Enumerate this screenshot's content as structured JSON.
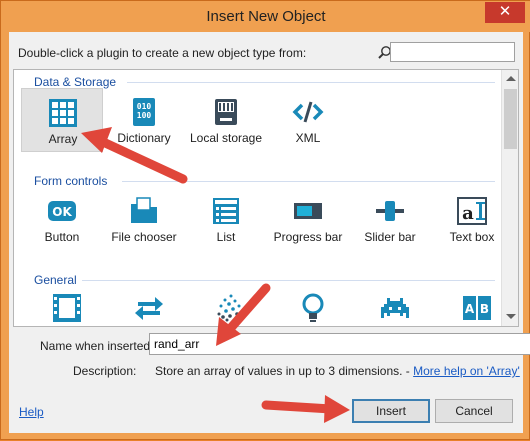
{
  "window": {
    "title": "Insert New Object",
    "close_glyph": "✕"
  },
  "instruction": "Double-click a plugin to create a new object type from:",
  "search": {
    "value": "",
    "placeholder": ""
  },
  "categories": [
    {
      "label": "Data & Storage",
      "items": [
        {
          "label": "Array",
          "icon": "grid-icon"
        },
        {
          "label": "Dictionary",
          "icon": "binary-icon"
        },
        {
          "label": "Local storage",
          "icon": "storage-icon"
        },
        {
          "label": "XML",
          "icon": "code-icon"
        }
      ]
    },
    {
      "label": "Form controls",
      "items": [
        {
          "label": "Button",
          "icon": "ok-button-icon"
        },
        {
          "label": "File chooser",
          "icon": "folder-icon"
        },
        {
          "label": "List",
          "icon": "list-icon"
        },
        {
          "label": "Progress bar",
          "icon": "progress-bar-icon"
        },
        {
          "label": "Slider bar",
          "icon": "slider-icon"
        },
        {
          "label": "Text box",
          "icon": "text-cursor-icon"
        }
      ]
    },
    {
      "label": "General",
      "items": [
        {
          "label": "",
          "icon": "film-icon"
        },
        {
          "label": "",
          "icon": "repeat-icon"
        },
        {
          "label": "",
          "icon": "particles-icon"
        },
        {
          "label": "",
          "icon": "lightbulb-icon"
        },
        {
          "label": "",
          "icon": "space-invader-icon"
        },
        {
          "label": "",
          "icon": "ab-tiles-icon"
        }
      ]
    }
  ],
  "selected_item": "Array",
  "name_field": {
    "label": "Name when inserted:",
    "value": "rand_arr"
  },
  "description": {
    "label": "Description:",
    "text": "Store an array of values in up to 3 dimensions. - ",
    "link": "More help on 'Array'"
  },
  "help_link": "Help",
  "buttons": {
    "insert": "Insert",
    "cancel": "Cancel"
  },
  "colors": {
    "accent": "#1989b8",
    "title_bar": "#f0a050",
    "category_text": "#1b4fa0",
    "link": "#1a5bc4",
    "annotation_arrow": "#e0463a"
  }
}
